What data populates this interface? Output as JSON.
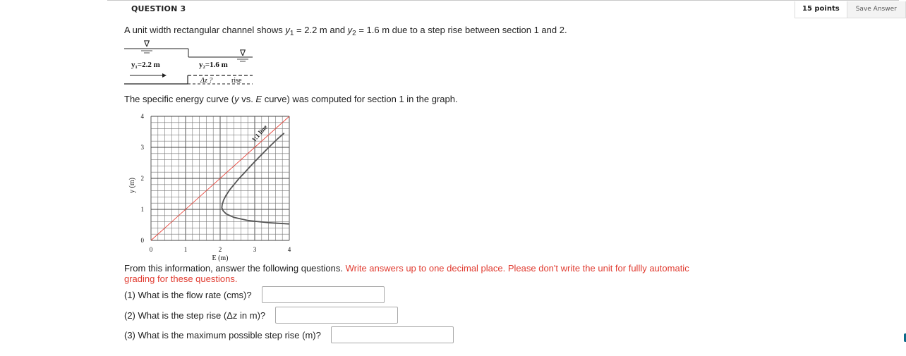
{
  "question": {
    "title": "QUESTION 3",
    "points": "15 points",
    "save_label": "Save Answer"
  },
  "stem": {
    "pre": "A unit width rectangular channel shows ",
    "y1_var": "y",
    "y1_sub": "1",
    "y1_val": " = 2.2 m and ",
    "y2_var": "y",
    "y2_sub": "2",
    "y2_val": " = 1.6 m due to a step rise between section 1 and 2."
  },
  "figure1": {
    "y1_label": "y₁=2.2 m",
    "y2_label": "y₂=1.6 m",
    "dz_label": "Δz ?",
    "rise_label": "rise",
    "water_symbol": "∇"
  },
  "para2": {
    "pre": "The specific energy curve (",
    "y": "y",
    "vs": " vs. ",
    "E": "E",
    "post": " curve) was computed for section 1 in the graph."
  },
  "chart_data": {
    "type": "line",
    "xlabel": "E (m)",
    "ylabel": "y (m)",
    "xlim": [
      0,
      4
    ],
    "ylim": [
      0,
      4
    ],
    "x_ticks": [
      "0",
      "1",
      "2",
      "3",
      "4"
    ],
    "y_ticks": [
      "0",
      "1",
      "2",
      "3",
      "4"
    ],
    "grid": true,
    "annotation": "1:1 line",
    "series": [
      {
        "x": [
          0,
          4
        ],
        "y": [
          0,
          4
        ],
        "color": "#e8463c"
      },
      {
        "x": [
          4.0,
          3.4,
          2.8,
          2.4,
          2.18,
          2.09,
          2.05,
          2.06,
          2.1,
          2.17,
          2.27,
          2.4,
          2.55,
          2.72,
          2.9,
          3.09,
          3.29,
          3.48,
          3.66,
          3.85
        ],
        "y": [
          0.53,
          0.57,
          0.64,
          0.74,
          0.85,
          0.95,
          1.05,
          1.15,
          1.3,
          1.45,
          1.62,
          1.8,
          2.0,
          2.2,
          2.42,
          2.64,
          2.87,
          3.08,
          3.27,
          3.46
        ],
        "color": "#555555"
      }
    ]
  },
  "para3": {
    "black": "From this information, answer the following questions. ",
    "red": "Write answers up to one decimal place. Please don't write the unit for fullly automatic grading for these questions."
  },
  "questions": [
    {
      "label": "(1) What is the flow rate (cms)?",
      "value": ""
    },
    {
      "label": "(2) What is the step rise (Δz in m)?",
      "value": ""
    },
    {
      "label": "(3) What is the maximum possible step rise (m)?",
      "value": ""
    }
  ]
}
